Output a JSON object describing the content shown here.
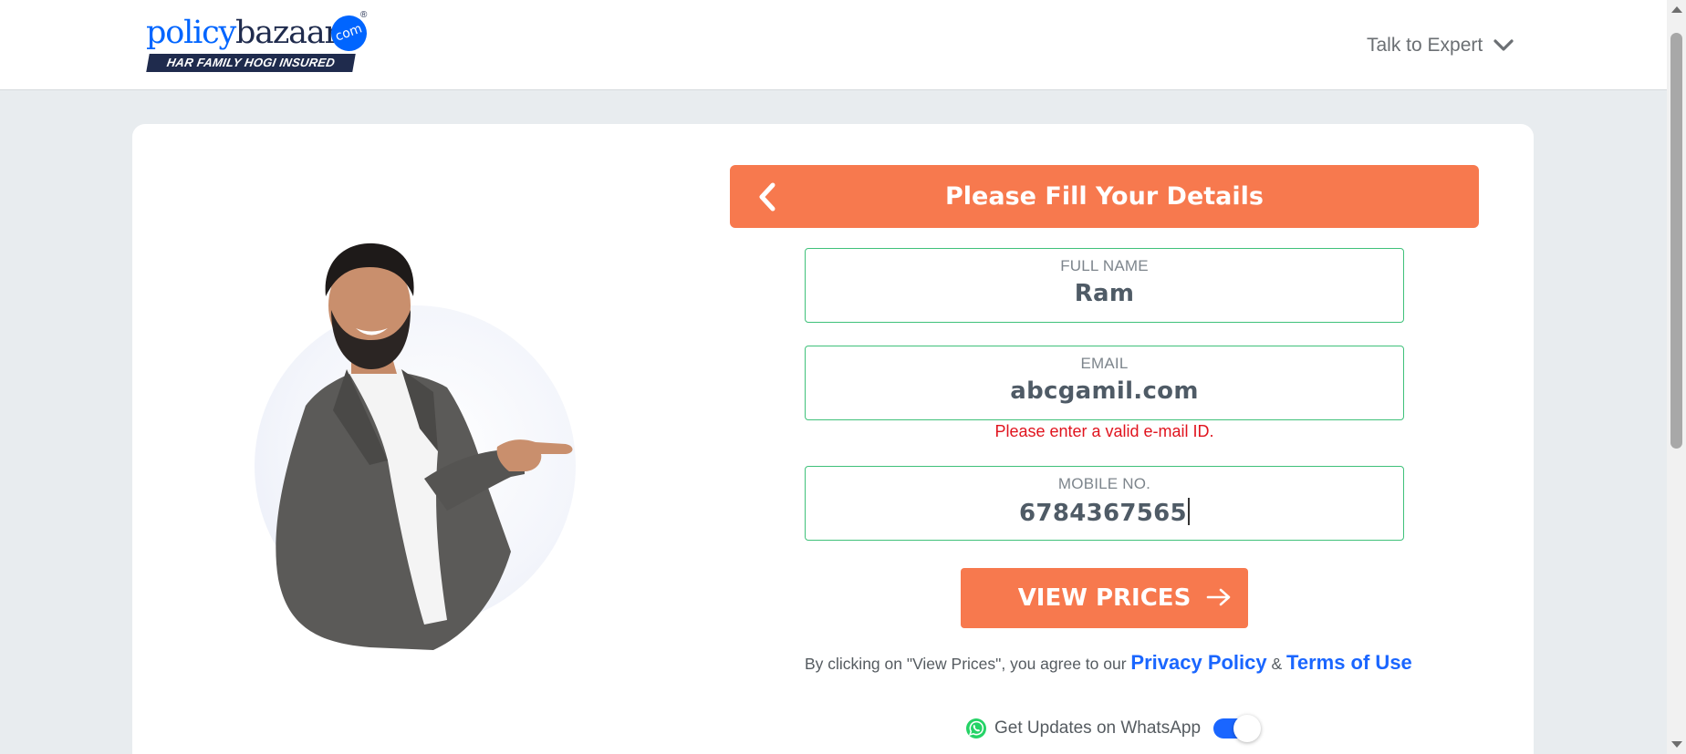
{
  "header": {
    "logo_policy": "policy",
    "logo_bazaar": "bazaar",
    "logo_com": "com",
    "logo_reg": "®",
    "logo_tagline": "HAR FAMILY HOGI INSURED",
    "talk_to_expert": "Talk to Expert"
  },
  "form": {
    "title": "Please Fill Your Details",
    "full_name_label": "FULL NAME",
    "full_name_value": "Ram",
    "email_label": "EMAIL",
    "email_value": "abcgamil.com",
    "email_error": "Please enter a valid e-mail ID.",
    "mobile_label": "MOBILE NO.",
    "mobile_value": "6784367565",
    "cta_label": "VIEW PRICES",
    "consent_prefix": "By clicking on \"View Prices\", you agree to our ",
    "privacy_link": "Privacy Policy",
    "consent_and": " & ",
    "terms_link": "Terms of Use",
    "whatsapp_label": "Get Updates on WhatsApp",
    "whatsapp_enabled": true
  },
  "colors": {
    "accent": "#f7794e",
    "brand_blue": "#0065ff",
    "field_border": "#3fc17a",
    "error": "#e0141e",
    "link": "#1a66ff"
  },
  "icons": [
    "chevron-down-icon",
    "back-arrow-icon",
    "arrow-right-icon",
    "whatsapp-icon",
    "person-image"
  ]
}
